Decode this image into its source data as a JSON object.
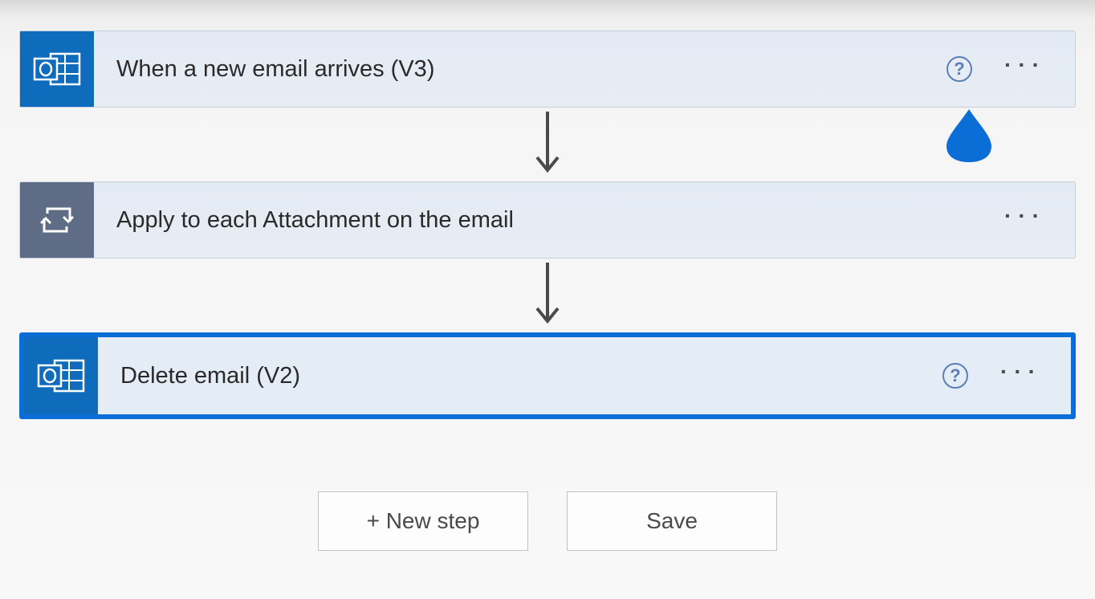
{
  "steps": [
    {
      "title": "When a new email arrives (V3)",
      "iconType": "outlook",
      "showHelp": true,
      "selected": false
    },
    {
      "title": "Apply to each Attachment on the email",
      "iconType": "loop",
      "showHelp": false,
      "selected": false
    },
    {
      "title": "Delete email (V2)",
      "iconType": "outlook",
      "showHelp": true,
      "selected": true
    }
  ],
  "buttons": {
    "newStep": "+ New step",
    "save": "Save"
  },
  "helpSymbol": "?",
  "moreSymbol": "···"
}
